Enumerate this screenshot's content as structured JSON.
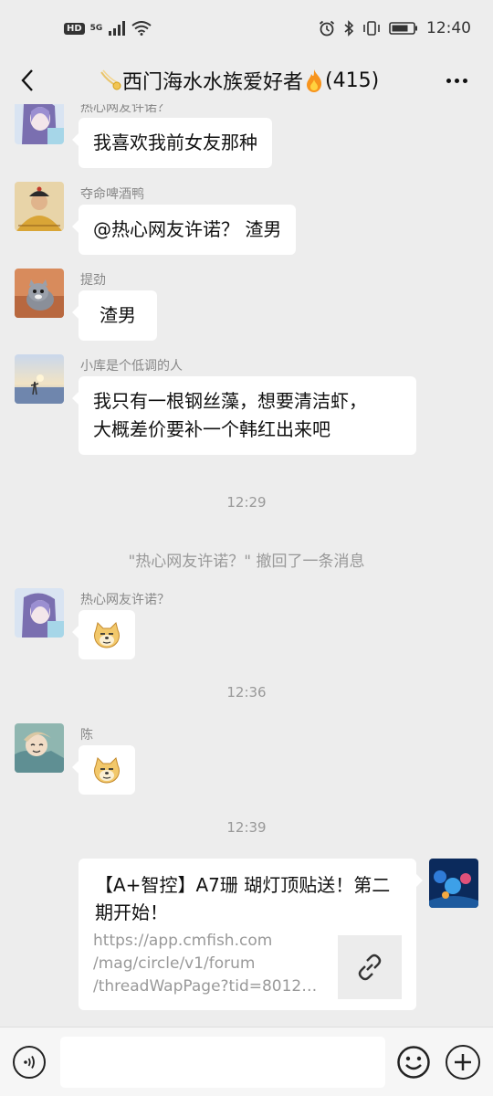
{
  "status_bar": {
    "hd": "HD",
    "network": "5G",
    "time": "12:40"
  },
  "nav": {
    "title": "西门海水水族爱好者",
    "title_prefix_icon": "comet-icon",
    "title_suffix_icon": "fire-icon",
    "member_count": "(415)"
  },
  "messages": [
    {
      "sender": "热心网友许诺？",
      "text": "我喜欢我前女友那种",
      "avatar": "anime-girl-avatar"
    },
    {
      "sender": "夺命啤酒鸭",
      "text": "@热心网友许诺？  渣男",
      "avatar": "qing-official-avatar"
    },
    {
      "sender": "提劲",
      "text": "渣男",
      "avatar": "cat-avatar"
    },
    {
      "sender": "小库是个低调的人",
      "text_lines": [
        "我只有一根钢丝藻，想要清洁虾，",
        "大概差价要补一个韩红出来吧"
      ],
      "avatar": "sunset-person-avatar"
    }
  ],
  "time_1": "12:29",
  "system_message": "\"热心网友许诺？\" 撤回了一条消息",
  "message_5": {
    "sender": "热心网友许诺？",
    "sticker": "doge-icon"
  },
  "time_2": "12:36",
  "message_6": {
    "sender": "陈",
    "sticker": "doge-icon"
  },
  "time_3": "12:39",
  "link_card": {
    "title": "【A+智控】A7珊 瑚灯顶贴送！第二期开始！",
    "url_lines": [
      "https://app.cmfish.com",
      "/mag/circle/v1/forum",
      "/threadWapPage?tid=80121..."
    ],
    "thumb_icon": "link-icon"
  },
  "input": {
    "placeholder": ""
  },
  "colors": {
    "background": "#ededed",
    "bubble": "#ffffff",
    "meta_text": "#999999"
  }
}
